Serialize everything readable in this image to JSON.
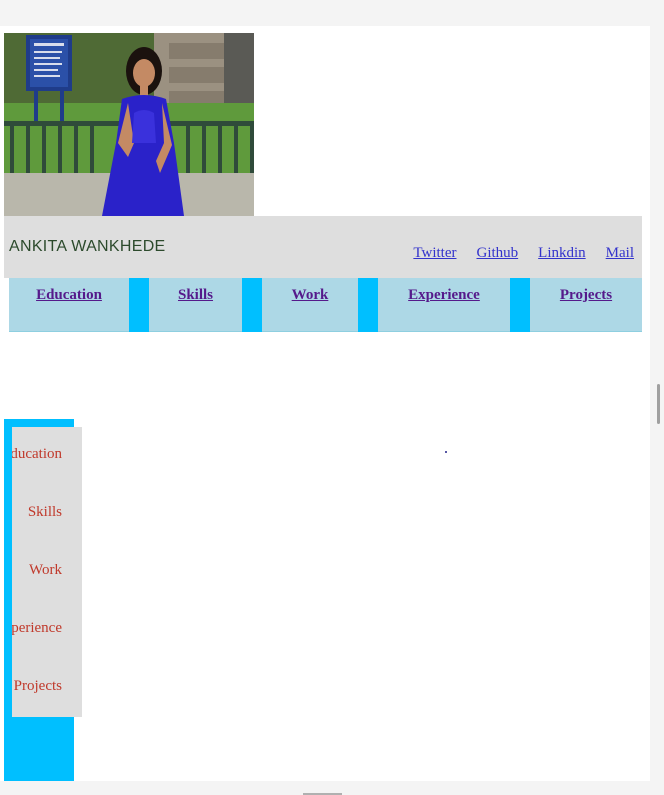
{
  "header": {
    "name": "ANKITA WANKHEDE",
    "social_links": [
      "Twitter",
      "Github",
      "Linkdin",
      "Mail"
    ]
  },
  "topnav": {
    "items": [
      "Education",
      "Skills",
      "Work",
      "Experience",
      "Projects"
    ]
  },
  "sidebar": {
    "items": [
      "Education",
      "Skills",
      "Work",
      "Experience",
      "Projects"
    ]
  },
  "colors": {
    "nav_accent": "#00bfff",
    "nav_cell": "#add8e6",
    "header_bar": "#dedede",
    "link": "#3333cc",
    "visited_link": "#551a8b",
    "sidebar_link": "#c0392b"
  }
}
